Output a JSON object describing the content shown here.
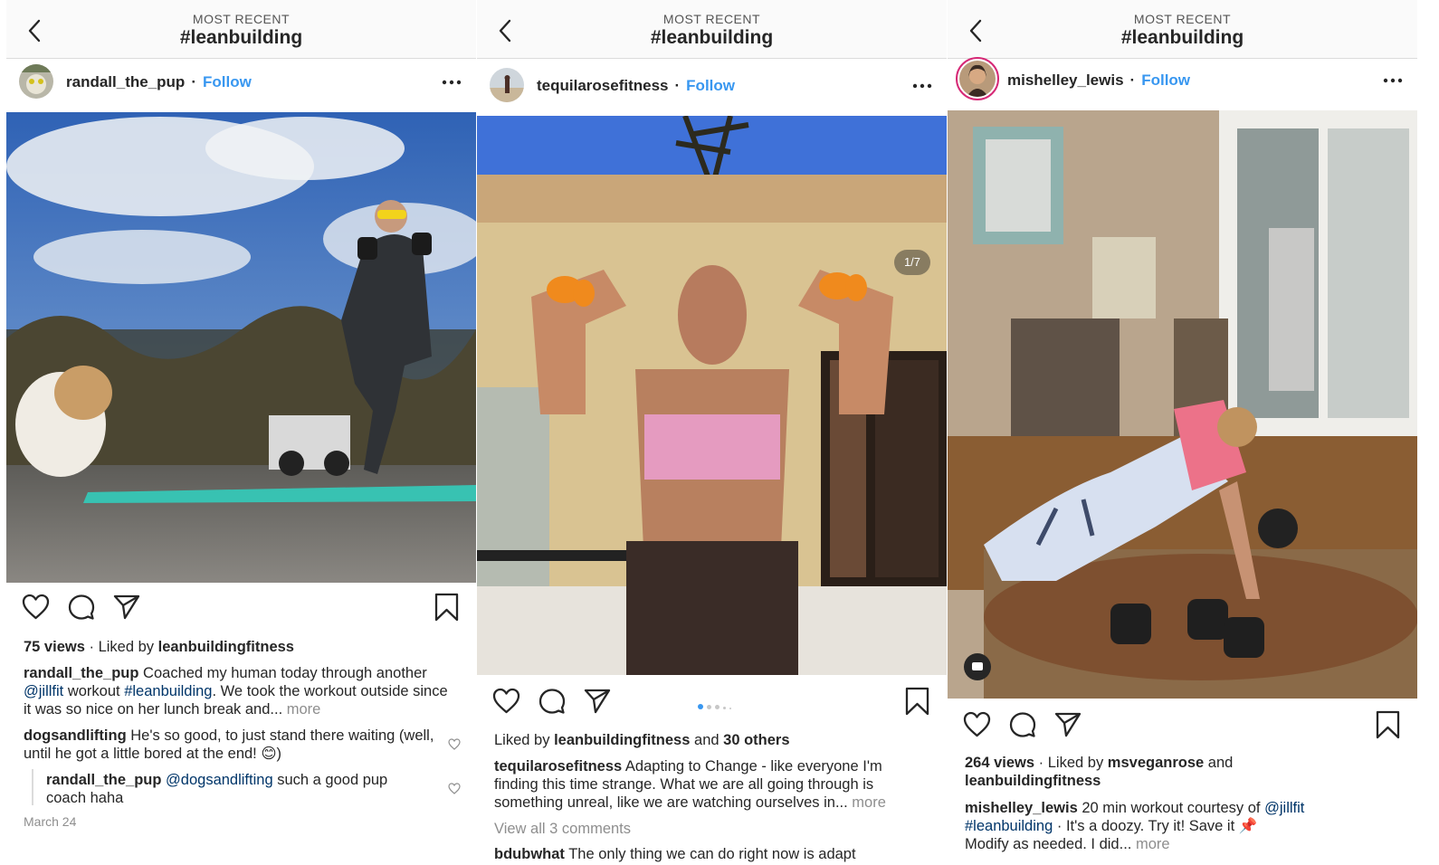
{
  "colors": {
    "accent": "#3897f0",
    "text": "#262626",
    "muted": "#8e8e8e",
    "mention": "#003569"
  },
  "icons": [
    "chevron-left-icon",
    "more-dots-icon",
    "heart-icon",
    "comment-icon",
    "share-icon",
    "bookmark-icon"
  ],
  "header": {
    "subtitle": "MOST RECENT",
    "title": "#leanbuilding"
  },
  "posts": [
    {
      "username": "randall_the_pup",
      "follow": "Follow",
      "dot": "·",
      "views": "75 views",
      "liked_prefix": "· Liked by",
      "liked_by": "leanbuildingfitness",
      "caption_user": "randall_the_pup",
      "caption_1": "Coached my human today through another",
      "mention": "@jillfit",
      "caption_2": "workout",
      "hashtag": "#leanbuilding",
      "caption_3": ". We took the workout outside since it was so nice on her lunch break and...",
      "more": "more",
      "comments": [
        {
          "user": "dogsandlifting",
          "text": "He's so good, to just stand there waiting (well, until he got a little bored at the end! 😊)"
        },
        {
          "user": "randall_the_pup",
          "mention": "@dogsandlifting",
          "text": "such a good pup coach haha"
        }
      ],
      "date": "March 24"
    },
    {
      "username": "tequilarosefitness",
      "follow": "Follow",
      "dot": "·",
      "counter": "1/7",
      "liked_prefix": "Liked by",
      "liked_by": "leanbuildingfitness",
      "liked_and": "and",
      "liked_others": "30 others",
      "caption_user": "tequilarosefitness",
      "caption": "Adapting to Change - like everyone I'm finding this time strange. What we are all going through is something unreal, like we are watching ourselves in...",
      "more": "more",
      "view_comments": "View all 3 comments",
      "next_user": "bdubwhat",
      "next_text": "The only thing we can do right now is adapt"
    },
    {
      "username": "mishelley_lewis",
      "follow": "Follow",
      "dot": "·",
      "views": "264 views",
      "liked_prefix": "· Liked by",
      "liked_by": "msveganrose",
      "liked_and": "and",
      "liked_by_2": "leanbuildingfitness",
      "caption_user": "mishelley_lewis",
      "caption_1": "20 min workout courtesy of",
      "mention": "@jillfit",
      "hashtag": "#leanbuilding",
      "caption_2": "· It's a doozy. Try it! Save it 📌",
      "caption_3": "Modify as needed. I did...",
      "more": "more"
    }
  ]
}
